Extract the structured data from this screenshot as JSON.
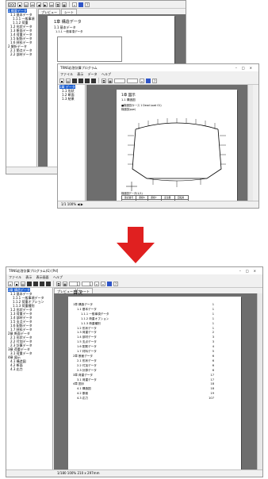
{
  "win_top": {
    "title": "DOC",
    "tree_items": [
      {
        "label": "1 概要データ",
        "selected": true
      },
      {
        "label": "1.1 基本データ",
        "selected": false
      },
      {
        "label": "1.1.1 一般事項",
        "selected": false
      },
      {
        "label": "1.1.2 荷重",
        "selected": false
      },
      {
        "label": "1.2 形状データ",
        "selected": false
      },
      {
        "label": "1.3 断面データ",
        "selected": false
      },
      {
        "label": "1.4 荷重データ",
        "selected": false
      },
      {
        "label": "1.5 配筋データ",
        "selected": false
      },
      {
        "label": "1.6 材料データ",
        "selected": false
      },
      {
        "label": "2 解析データ",
        "selected": false
      },
      {
        "label": "2.1 節点データ",
        "selected": false
      },
      {
        "label": "2.2 部材データ",
        "selected": false
      }
    ],
    "tabs": [
      "プレビュー",
      "シート"
    ],
    "page": {
      "heading": "1章 構造データ",
      "section": "1.1 基本データ",
      "subsection": "1.1.1 一般事項データ"
    }
  },
  "win_mid": {
    "title": "TRNS応答計算プログラム",
    "menu": [
      "ファイル",
      "表示",
      "データ",
      "ヘルプ"
    ],
    "tree_items": [
      {
        "label": "1章 データ",
        "selected": true
      },
      {
        "label": "1.1 形状",
        "selected": false
      },
      {
        "label": "1.2 断面",
        "selected": false
      },
      {
        "label": "1.3 結果",
        "selected": false
      }
    ],
    "page": {
      "heading": "1章 図示",
      "section": "1.1 構造図",
      "caption": "■構造図(ケース 1 Dead Load 01)",
      "subcaption": "構造図(ppe)",
      "table_title": "構造図データ(1/1)",
      "table_header": [
        "節点番号",
        "座標X",
        "座標Y",
        "変位量",
        "回転角"
      ],
      "table_rows": [
        [
          "1",
          "1.000",
          "36.000",
          "36.000",
          "37.000"
        ],
        [
          "2",
          "1.000",
          "54.000",
          "54.000",
          "52.000"
        ]
      ]
    },
    "status": "1/1  100%  ◀ ▶"
  },
  "win_main": {
    "title": "TRNS応答計算プログラム(G) [Pd]",
    "menu": [
      "ファイル",
      "表示",
      "表示画面",
      "ヘルプ"
    ],
    "toolbar": {
      "page_input": "1",
      "of_pages": "1"
    },
    "tabs": [
      "プレビュー",
      "シート"
    ],
    "tree_items": [
      {
        "label": "1章 構造データ",
        "selected": true
      },
      {
        "label": "1.1 基本データ",
        "selected": false
      },
      {
        "label": "1.1.1 一般事項データ",
        "selected": false
      },
      {
        "label": "1.1.2 荷重オプション",
        "selected": false
      },
      {
        "label": "1.1.3 荷重種別",
        "selected": false
      },
      {
        "label": "1.2 形状データ",
        "selected": false
      },
      {
        "label": "1.3 荷重データ",
        "selected": false
      },
      {
        "label": "1.4 部材データ",
        "selected": false
      },
      {
        "label": "1.5 支点データ",
        "selected": false
      },
      {
        "label": "1.6 配筋データ",
        "selected": false
      },
      {
        "label": "1.7 材料データ",
        "selected": false
      },
      {
        "label": "2章 断面データ",
        "selected": false
      },
      {
        "label": "2.1 形状データ",
        "selected": false
      },
      {
        "label": "2.2 付加データ",
        "selected": false
      },
      {
        "label": "2.3 計算データ",
        "selected": false
      },
      {
        "label": "3章 荷重データ",
        "selected": false
      },
      {
        "label": "3.1 荷重データ",
        "selected": false
      },
      {
        "label": "4章 図示",
        "selected": false
      },
      {
        "label": "4.1 構造図",
        "selected": false
      },
      {
        "label": "4.2 断面",
        "selected": false
      },
      {
        "label": "4.3 応力",
        "selected": false
      }
    ],
    "page": {
      "toc_title": "目次",
      "toc": [
        {
          "label": "1章 構造データ",
          "page": "1",
          "indent": 0
        },
        {
          "label": "1.1 基本データ",
          "page": "1",
          "indent": 1
        },
        {
          "label": "1.1.1 一般事項データ",
          "page": "1",
          "indent": 2
        },
        {
          "label": "1.1.2 荷重オプション",
          "page": "1",
          "indent": 2
        },
        {
          "label": "1.1.3 荷重種別",
          "page": "1",
          "indent": 2
        },
        {
          "label": "1.2 形状データ",
          "page": "1",
          "indent": 1
        },
        {
          "label": "1.3 荷重データ",
          "page": "2",
          "indent": 1
        },
        {
          "label": "1.4 部材データ",
          "page": "3",
          "indent": 1
        },
        {
          "label": "1.5 支点データ",
          "page": "3",
          "indent": 1
        },
        {
          "label": "1.6 配筋データ",
          "page": "4",
          "indent": 1
        },
        {
          "label": "1.7 材料データ",
          "page": "5",
          "indent": 1
        },
        {
          "label": "2章 断面データ",
          "page": "6",
          "indent": 0
        },
        {
          "label": "2.1 形状データ",
          "page": "6",
          "indent": 1
        },
        {
          "label": "2.2 付加データ",
          "page": "6",
          "indent": 1
        },
        {
          "label": "2.3 計算データ",
          "page": "6",
          "indent": 1
        },
        {
          "label": "3章 荷重データ",
          "page": "17",
          "indent": 0
        },
        {
          "label": "3.1 荷重データ",
          "page": "17",
          "indent": 1
        },
        {
          "label": "4章 図示",
          "page": "18",
          "indent": 0
        },
        {
          "label": "4.1 構造図",
          "page": "18",
          "indent": 1
        },
        {
          "label": "4.2 断面",
          "page": "19",
          "indent": 1
        },
        {
          "label": "4.3 応力",
          "page": "107",
          "indent": 1
        }
      ]
    },
    "status": "1/180  100%  210 x 297mm"
  },
  "colors": {
    "arrow": "#e02020",
    "selection": "#1d5fd0",
    "viewer_bg": "#6e6e6e"
  }
}
